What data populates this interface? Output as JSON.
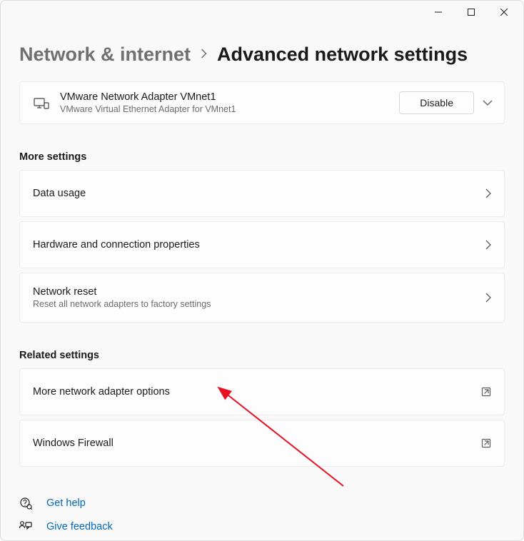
{
  "breadcrumb": {
    "parent": "Network & internet",
    "current": "Advanced network settings"
  },
  "adapter": {
    "name": "VMware Network Adapter VMnet1",
    "description": "VMware Virtual Ethernet Adapter for VMnet1",
    "disable_label": "Disable"
  },
  "sections": {
    "more_settings": {
      "header": "More settings",
      "items": [
        {
          "title": "Data usage"
        },
        {
          "title": "Hardware and connection properties"
        },
        {
          "title": "Network reset",
          "description": "Reset all network adapters to factory settings"
        }
      ]
    },
    "related_settings": {
      "header": "Related settings",
      "items": [
        {
          "title": "More network adapter options"
        },
        {
          "title": "Windows Firewall"
        }
      ]
    }
  },
  "help": {
    "get_help": "Get help",
    "give_feedback": "Give feedback"
  }
}
